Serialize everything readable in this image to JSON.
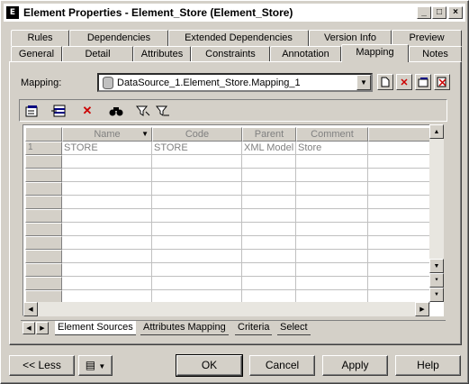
{
  "window": {
    "title": "Element Properties - Element_Store (Element_Store)",
    "app_icon_glyph": "E",
    "controls": {
      "minimize": "_",
      "maximize": "□",
      "close": "×"
    }
  },
  "tabs": {
    "row_back": [
      "Rules",
      "Dependencies",
      "Extended Dependencies",
      "Version Info",
      "Preview"
    ],
    "row_front": [
      "General",
      "Detail",
      "Attributes",
      "Constraints",
      "Annotation",
      "Mapping",
      "Notes"
    ],
    "active": "Mapping"
  },
  "mapping": {
    "label": "Mapping:",
    "value": "DataSource_1.Element_Store.Mapping_1"
  },
  "toolbar": {
    "icons": [
      "properties-icon",
      "add-rows-icon",
      "delete-icon",
      "find-icon",
      "filter-icon",
      "clear-filter-icon"
    ]
  },
  "grid": {
    "columns": [
      "Name",
      "Code",
      "Parent",
      "Comment"
    ],
    "rows": [
      {
        "num": "1",
        "name": "STORE",
        "code": "STORE",
        "parent": "XML Model",
        "comment": "Store"
      }
    ]
  },
  "sheet_tabs": [
    "Element Sources",
    "Attributes Mapping",
    "Criteria",
    "Select"
  ],
  "buttons": {
    "less": "<< Less",
    "ok": "OK",
    "cancel": "Cancel",
    "apply": "Apply",
    "help": "Help"
  },
  "colors": {
    "face": "#d4d0c8",
    "delete_red": "#cc0000",
    "toolbar_blue": "#000080"
  }
}
